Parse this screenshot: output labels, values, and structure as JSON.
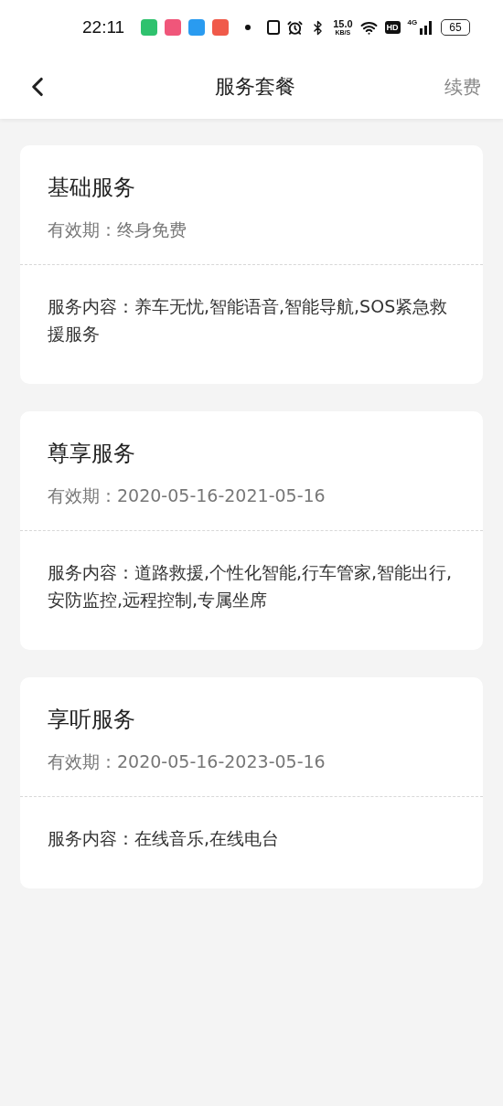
{
  "status_bar": {
    "time": "22:11",
    "apps": [
      {
        "color": "#2fc26e"
      },
      {
        "color": "#f0567a"
      },
      {
        "color": "#2a9bf0"
      },
      {
        "color": "#f05a4a"
      }
    ],
    "speed": "15.0",
    "speed_unit": "KB/S",
    "hd": "HD",
    "network": "4G",
    "battery": "65"
  },
  "header": {
    "title": "服务套餐",
    "action": "续费"
  },
  "cards": [
    {
      "title": "基础服务",
      "validity": "有效期：终身免费",
      "content": "服务内容：养车无忧,智能语音,智能导航,SOS紧急救援服务"
    },
    {
      "title": "尊享服务",
      "validity": "有效期：2020-05-16-2021-05-16",
      "content": "服务内容：道路救援,个性化智能,行车管家,智能出行,安防监控,远程控制,专属坐席"
    },
    {
      "title": "享听服务",
      "validity": "有效期：2020-05-16-2023-05-16",
      "content": "服务内容：在线音乐,在线电台"
    }
  ]
}
